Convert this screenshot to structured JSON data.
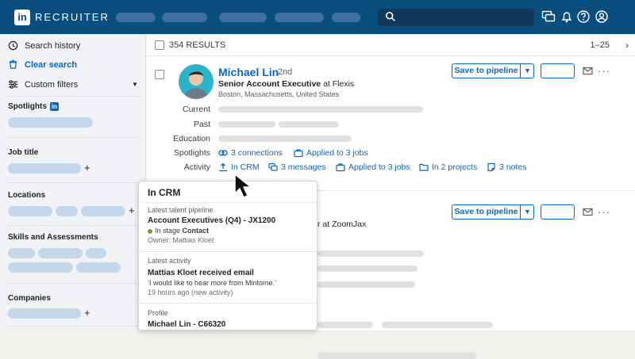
{
  "header": {
    "logo": "in",
    "brand": "RECRUITER"
  },
  "sidebar": {
    "search_history": "Search history",
    "clear_search": "Clear search",
    "custom_filters": "Custom filters",
    "spotlights": "Spotlights",
    "spotlights_badge": "in",
    "job_title": "Job title",
    "locations": "Locations",
    "skills": "Skills and Assessments",
    "companies": "Companies",
    "plus": "+"
  },
  "results": {
    "count": "354 RESULTS",
    "paging": "1–25",
    "next": "›"
  },
  "card1": {
    "name": "Michael Lin",
    "degree": "· 2nd",
    "title": "Senior Account Executive",
    "at": " at ",
    "company": "Flexis",
    "location": "Boston, Massachusetts, United States",
    "labels": {
      "current": "Current",
      "past": "Past",
      "education": "Education",
      "spotlights": "Spotlights",
      "activity": "Activity"
    },
    "spotlights": {
      "connections": "3 connections",
      "applied": "Applied to 3 jobs"
    },
    "activity": {
      "crm": "In CRM",
      "messages": "3 messages",
      "applied": "Applied to 3 jobs",
      "projects": "In 2 projects",
      "notes": "3 notes"
    }
  },
  "card2": {
    "partial_text": "r at ZoomJax"
  },
  "buttons": {
    "save_pipeline": "Save to pipeline",
    "more": "···"
  },
  "popover": {
    "title": "In CRM",
    "pipeline_caption": "Latest talent pipeline",
    "pipeline_name": "Account Executives (Q4) - JX1200",
    "stage_prefix": "In stage ",
    "stage_value": "Contact",
    "owner": "Owner: Mattias Kloet",
    "activity_caption": "Latest activity",
    "activity_title": "Mattias Kloet received email",
    "activity_quote": "‘I would like to hear more from Mintome.’",
    "activity_time": "19 hours ago (new activity)",
    "profile_caption": "Profile",
    "profile_id": "Michael Lin - C66320"
  },
  "colors": {
    "brand": "#0a4e80",
    "accent": "#0a66c2",
    "stage_dot": "#7a9a3c"
  }
}
